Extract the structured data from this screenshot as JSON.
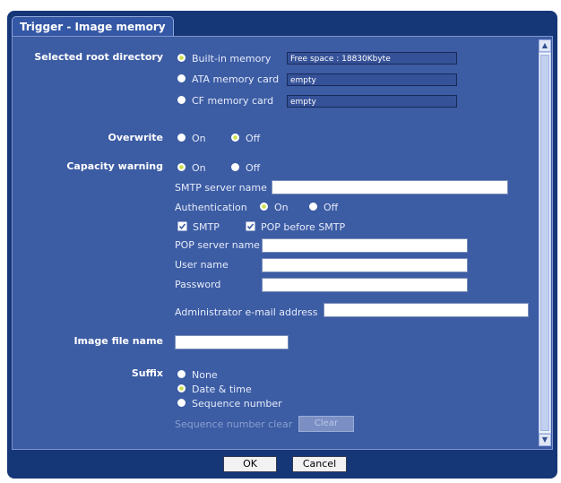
{
  "tab": {
    "title": "Trigger - Image memory"
  },
  "root_directory": {
    "label": "Selected root directory",
    "options": [
      {
        "label": "Built-in memory",
        "info": "Free space : 18830Kbyte",
        "selected": true
      },
      {
        "label": "ATA memory card",
        "info": "empty",
        "selected": false
      },
      {
        "label": "CF memory card",
        "info": "empty",
        "selected": false
      }
    ]
  },
  "overwrite": {
    "label": "Overwrite",
    "on": "On",
    "off": "Off",
    "selected": "Off"
  },
  "capacity_warning": {
    "label": "Capacity warning",
    "on": "On",
    "off": "Off",
    "selected": "On",
    "smtp_server_label": "SMTP server name",
    "smtp_server_value": "",
    "authentication_label": "Authentication",
    "auth_on": "On",
    "auth_off": "Off",
    "auth_selected": "On",
    "smtp_check": "SMTP",
    "pop_before_smtp_check": "POP before SMTP",
    "pop_server_label": "POP server name",
    "pop_server_value": "",
    "user_name_label": "User name",
    "user_name_value": "",
    "password_label": "Password",
    "password_value": "",
    "admin_email_label": "Administrator e-mail address",
    "admin_email_value": ""
  },
  "image_file_name": {
    "label": "Image file name",
    "value": ""
  },
  "suffix": {
    "label": "Suffix",
    "options": [
      {
        "label": "None",
        "selected": false
      },
      {
        "label": "Date & time",
        "selected": true
      },
      {
        "label": "Sequence number",
        "selected": false
      }
    ],
    "sequence_clear_label": "Sequence number clear",
    "clear_button": "Clear"
  },
  "buttons": {
    "ok": "OK",
    "cancel": "Cancel"
  },
  "colors": {
    "background": "#153677",
    "panel": "#3c5ca4",
    "radio_dot": "#c9e04a"
  }
}
